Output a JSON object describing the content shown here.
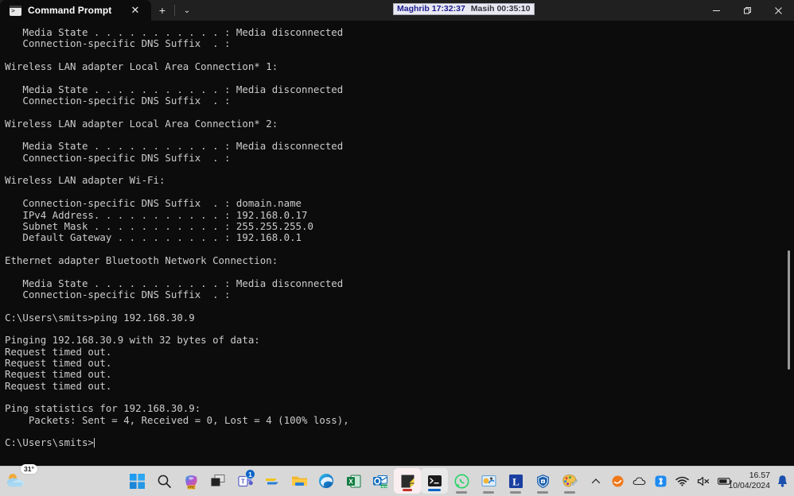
{
  "window": {
    "tab": {
      "title": "Command Prompt",
      "icon": "terminal-icon",
      "close_label": "✕"
    },
    "new_tab_label": "+",
    "tab_menu_label": "⌄",
    "controls": {
      "minimize": "minimize",
      "maximize": "maximize",
      "close": "close"
    }
  },
  "overlay_widget": {
    "prayer_label": "Maghrib 17:32:37",
    "countdown_label": "Masih 00:35:10",
    "text_color": "#1b1b8f",
    "background": "#e9e9f2"
  },
  "terminal": {
    "background": "#0c0c0c",
    "foreground": "#cccccc",
    "cursor": "block",
    "lines": [
      "   Media State . . . . . . . . . . . : Media disconnected",
      "   Connection-specific DNS Suffix  . :",
      "",
      "Wireless LAN adapter Local Area Connection* 1:",
      "",
      "   Media State . . . . . . . . . . . : Media disconnected",
      "   Connection-specific DNS Suffix  . :",
      "",
      "Wireless LAN adapter Local Area Connection* 2:",
      "",
      "   Media State . . . . . . . . . . . : Media disconnected",
      "   Connection-specific DNS Suffix  . :",
      "",
      "Wireless LAN adapter Wi-Fi:",
      "",
      "   Connection-specific DNS Suffix  . : domain.name",
      "   IPv4 Address. . . . . . . . . . . : 192.168.0.17",
      "   Subnet Mask . . . . . . . . . . . : 255.255.255.0",
      "   Default Gateway . . . . . . . . . : 192.168.0.1",
      "",
      "Ethernet adapter Bluetooth Network Connection:",
      "",
      "   Media State . . . . . . . . . . . : Media disconnected",
      "   Connection-specific DNS Suffix  . :",
      "",
      "C:\\Users\\smits>ping 192.168.30.9",
      "",
      "Pinging 192.168.30.9 with 32 bytes of data:",
      "Request timed out.",
      "Request timed out.",
      "Request timed out.",
      "Request timed out.",
      "",
      "Ping statistics for 192.168.30.9:",
      "    Packets: Sent = 4, Received = 0, Lost = 4 (100% loss),",
      ""
    ],
    "prompt": "C:\\Users\\smits>"
  },
  "taskbar": {
    "weather": {
      "temperature": "31°",
      "icon": "partly-cloudy-icon"
    },
    "items": [
      {
        "name": "start-button",
        "icon": "windows-logo-icon",
        "label": "Start"
      },
      {
        "name": "search-button",
        "icon": "search-icon",
        "label": "Search"
      },
      {
        "name": "copilot-button",
        "icon": "copilot-icon",
        "label": "Copilot"
      },
      {
        "name": "task-view-button",
        "icon": "task-view-icon",
        "label": "Task View"
      },
      {
        "name": "teams-button",
        "icon": "teams-icon",
        "label": "Microsoft Teams",
        "badge": "1"
      },
      {
        "name": "mail-button",
        "icon": "mail-arrow-icon",
        "label": "Mail"
      },
      {
        "name": "file-explorer-button",
        "icon": "folder-icon",
        "label": "File Explorer"
      },
      {
        "name": "edge-button",
        "icon": "edge-icon",
        "label": "Microsoft Edge"
      },
      {
        "name": "excel-button",
        "icon": "excel-icon",
        "label": "Excel"
      },
      {
        "name": "outlook-button",
        "icon": "outlook-icon",
        "label": "Outlook (new)"
      },
      {
        "name": "sticky-notes-button",
        "icon": "sticky-note-icon",
        "label": "Sticky Notes"
      },
      {
        "name": "terminal-button",
        "icon": "terminal-icon",
        "label": "Terminal"
      },
      {
        "name": "whatsapp-button",
        "icon": "whatsapp-icon",
        "label": "WhatsApp"
      },
      {
        "name": "media-player-button",
        "icon": "media-app-icon",
        "label": "Media"
      },
      {
        "name": "l-app-button",
        "icon": "letter-l-icon",
        "label": "L"
      },
      {
        "name": "security-button",
        "icon": "shield-icon",
        "label": "Security"
      },
      {
        "name": "paint-button",
        "icon": "paint-palette-icon",
        "label": "Paint"
      }
    ],
    "tray": [
      {
        "name": "tray-overflow-button",
        "icon": "chevron-up-icon",
        "label": "Show hidden icons"
      },
      {
        "name": "tray-app-button",
        "icon": "orange-circle-icon",
        "label": "Tray app"
      },
      {
        "name": "onedrive-button",
        "icon": "cloud-icon",
        "label": "OneDrive"
      },
      {
        "name": "bluetooth-button",
        "icon": "bluetooth-icon",
        "label": "Bluetooth"
      },
      {
        "name": "network-button",
        "icon": "wifi-icon",
        "label": "Network"
      },
      {
        "name": "volume-button",
        "icon": "speaker-muted-icon",
        "label": "Volume muted"
      },
      {
        "name": "battery-button",
        "icon": "battery-icon",
        "label": "Battery"
      }
    ],
    "clock": {
      "time": "16.57",
      "date": "10/04/2024"
    },
    "notifications": {
      "icon": "bell-icon",
      "label": "Notifications"
    },
    "accent_color": "#0a64c8",
    "background": "#d8d8d8"
  }
}
